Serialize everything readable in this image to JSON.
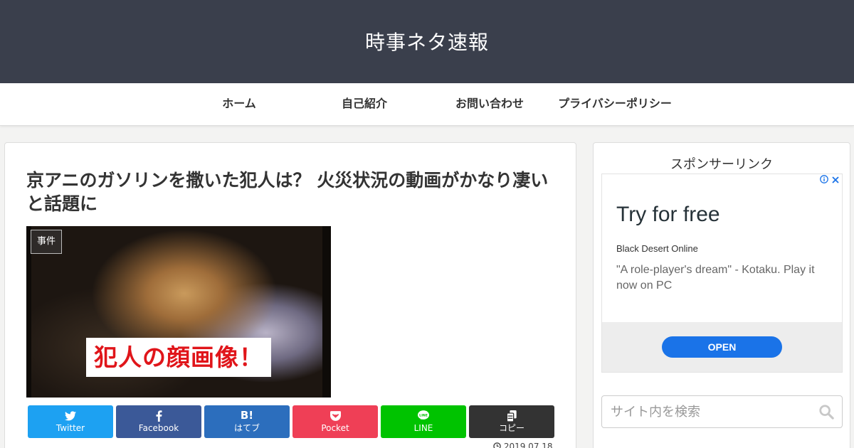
{
  "header": {
    "site_title": "時事ネタ速報"
  },
  "nav": {
    "items": [
      "ホーム",
      "自己紹介",
      "お問い合わせ",
      "プライバシーポリシー"
    ]
  },
  "article": {
    "title": "京アニのガソリンを撒いた犯人は？ 火災状況の動画がかなり凄いと話題に",
    "category": "事件",
    "eyecatch_caption": "犯人の顔画像！",
    "date": "2019.07.18"
  },
  "share": {
    "buttons": [
      {
        "icon": "twitter-icon",
        "label": "Twitter",
        "color": "#1da1f2"
      },
      {
        "icon": "facebook-icon",
        "label": "Facebook",
        "color": "#3b5998"
      },
      {
        "icon": "hatena-icon",
        "icon_text": "B!",
        "label": "はてブ",
        "color": "#2c6ebd"
      },
      {
        "icon": "pocket-icon",
        "label": "Pocket",
        "color": "#ef3f56"
      },
      {
        "icon": "line-icon",
        "label": "LINE",
        "color": "#00c300"
      },
      {
        "icon": "copy-icon",
        "label": "コピー",
        "color": "#333333"
      }
    ]
  },
  "sidebar": {
    "sponsor_heading": "スポンサーリンク",
    "ad": {
      "title": "Try for free",
      "advertiser": "Black Desert Online",
      "description": "\"A role-player's dream\" - Kotaku. Play it now on PC",
      "cta": "OPEN",
      "info_icon": "info-icon",
      "close_icon": "close-icon"
    },
    "search": {
      "placeholder": "サイト内を検索",
      "icon": "search-icon"
    }
  },
  "colors": {
    "header_bg": "#3a3f4c",
    "caption_red": "#e0151a",
    "ad_button": "#1a73e8"
  }
}
